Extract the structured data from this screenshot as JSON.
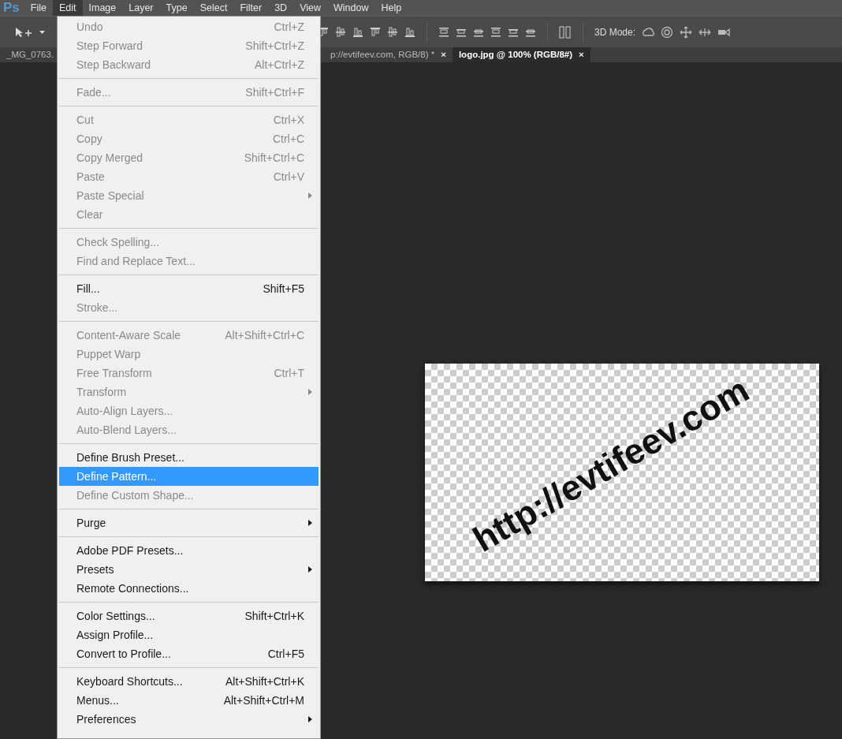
{
  "app_logo": "Ps",
  "menubar": [
    {
      "label": "File",
      "selected": false
    },
    {
      "label": "Edit",
      "selected": true
    },
    {
      "label": "Image",
      "selected": false
    },
    {
      "label": "Layer",
      "selected": false
    },
    {
      "label": "Type",
      "selected": false
    },
    {
      "label": "Select",
      "selected": false
    },
    {
      "label": "Filter",
      "selected": false
    },
    {
      "label": "3D",
      "selected": false
    },
    {
      "label": "View",
      "selected": false
    },
    {
      "label": "Window",
      "selected": false
    },
    {
      "label": "Help",
      "selected": false
    }
  ],
  "options_bar": {
    "mode_label": "3D Mode:"
  },
  "tabs": [
    {
      "label": "_MG_0763.",
      "selected": false
    },
    {
      "label": "p://evtifeev.com, RGB/8) *",
      "selected": false,
      "close": "×"
    },
    {
      "label": "logo.jpg @ 100% (RGB/8#)",
      "selected": true,
      "close": "×"
    }
  ],
  "edit_menu": [
    [
      {
        "label": "Undo",
        "shortcut": "Ctrl+Z",
        "disabled": true,
        "submenu": false,
        "selected": false
      },
      {
        "label": "Step Forward",
        "shortcut": "Shift+Ctrl+Z",
        "disabled": true,
        "submenu": false,
        "selected": false
      },
      {
        "label": "Step Backward",
        "shortcut": "Alt+Ctrl+Z",
        "disabled": true,
        "submenu": false,
        "selected": false
      }
    ],
    [
      {
        "label": "Fade...",
        "shortcut": "Shift+Ctrl+F",
        "disabled": true,
        "submenu": false,
        "selected": false
      }
    ],
    [
      {
        "label": "Cut",
        "shortcut": "Ctrl+X",
        "disabled": true,
        "submenu": false,
        "selected": false
      },
      {
        "label": "Copy",
        "shortcut": "Ctrl+C",
        "disabled": true,
        "submenu": false,
        "selected": false
      },
      {
        "label": "Copy Merged",
        "shortcut": "Shift+Ctrl+C",
        "disabled": true,
        "submenu": false,
        "selected": false
      },
      {
        "label": "Paste",
        "shortcut": "Ctrl+V",
        "disabled": true,
        "submenu": false,
        "selected": false
      },
      {
        "label": "Paste Special",
        "disabled": true,
        "submenu": true,
        "selected": false
      },
      {
        "label": "Clear",
        "disabled": true,
        "submenu": false,
        "selected": false
      }
    ],
    [
      {
        "label": "Check Spelling...",
        "disabled": true,
        "submenu": false,
        "selected": false
      },
      {
        "label": "Find and Replace Text...",
        "disabled": true,
        "submenu": false,
        "selected": false
      }
    ],
    [
      {
        "label": "Fill...",
        "shortcut": "Shift+F5",
        "disabled": false,
        "submenu": false,
        "selected": false
      },
      {
        "label": "Stroke...",
        "disabled": true,
        "submenu": false,
        "selected": false
      }
    ],
    [
      {
        "label": "Content-Aware Scale",
        "shortcut": "Alt+Shift+Ctrl+C",
        "disabled": true,
        "submenu": false,
        "selected": false
      },
      {
        "label": "Puppet Warp",
        "disabled": true,
        "submenu": false,
        "selected": false
      },
      {
        "label": "Free Transform",
        "shortcut": "Ctrl+T",
        "disabled": true,
        "submenu": false,
        "selected": false
      },
      {
        "label": "Transform",
        "disabled": true,
        "submenu": true,
        "selected": false
      },
      {
        "label": "Auto-Align Layers...",
        "disabled": true,
        "submenu": false,
        "selected": false
      },
      {
        "label": "Auto-Blend Layers...",
        "disabled": true,
        "submenu": false,
        "selected": false
      }
    ],
    [
      {
        "label": "Define Brush Preset...",
        "disabled": false,
        "submenu": false,
        "selected": false
      },
      {
        "label": "Define Pattern...",
        "disabled": false,
        "submenu": false,
        "selected": true
      },
      {
        "label": "Define Custom Shape...",
        "disabled": true,
        "submenu": false,
        "selected": false
      }
    ],
    [
      {
        "label": "Purge",
        "disabled": false,
        "submenu": true,
        "selected": false
      }
    ],
    [
      {
        "label": "Adobe PDF Presets...",
        "disabled": false,
        "submenu": false,
        "selected": false
      },
      {
        "label": "Presets",
        "disabled": false,
        "submenu": true,
        "selected": false
      },
      {
        "label": "Remote Connections...",
        "disabled": false,
        "submenu": false,
        "selected": false
      }
    ],
    [
      {
        "label": "Color Settings...",
        "shortcut": "Shift+Ctrl+K",
        "disabled": false,
        "submenu": false,
        "selected": false
      },
      {
        "label": "Assign Profile...",
        "disabled": false,
        "submenu": false,
        "selected": false
      },
      {
        "label": "Convert to Profile...",
        "shortcut": "Ctrl+F5",
        "disabled": false,
        "submenu": false,
        "selected": false
      }
    ],
    [
      {
        "label": "Keyboard Shortcuts...",
        "shortcut": "Alt+Shift+Ctrl+K",
        "disabled": false,
        "submenu": false,
        "selected": false
      },
      {
        "label": "Menus...",
        "shortcut": "Alt+Shift+Ctrl+M",
        "disabled": false,
        "submenu": false,
        "selected": false
      },
      {
        "label": "Preferences",
        "disabled": false,
        "submenu": true,
        "selected": false
      }
    ]
  ],
  "document": {
    "text": "http://evtifeev.com"
  }
}
